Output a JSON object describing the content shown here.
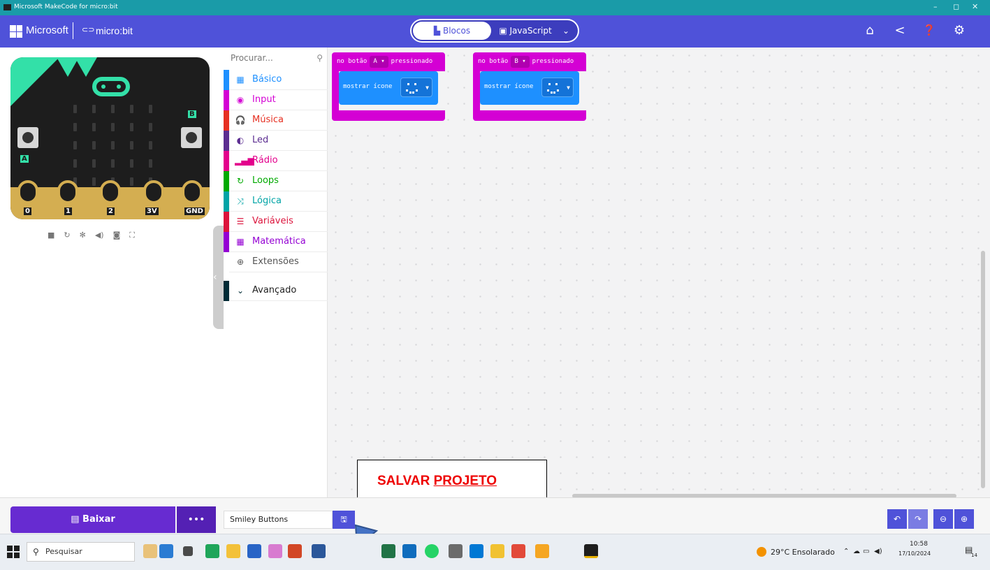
{
  "window": {
    "title": "Microsoft MakeCode for micro:bit",
    "controls": [
      "–",
      "◻",
      "✕"
    ]
  },
  "header": {
    "brand_microsoft": "Microsoft",
    "brand_microbit": "micro:bit",
    "mode_blocks": "Blocos",
    "mode_javascript": "JavaScript",
    "icons": [
      "home-icon",
      "share-icon",
      "help-icon",
      "settings-icon"
    ]
  },
  "simulator": {
    "button_a": "A",
    "button_b": "B",
    "pins": [
      "0",
      "1",
      "2",
      "3V",
      "GND"
    ],
    "controls": [
      "stop-icon",
      "restart-icon",
      "debug-icon",
      "mute-icon",
      "screenshot-icon",
      "fullscreen-icon"
    ]
  },
  "toolbox": {
    "search_placeholder": "Procurar...",
    "categories": [
      {
        "label": "Básico",
        "color": "#1e90ff",
        "icon": "grid-icon"
      },
      {
        "label": "Input",
        "color": "#d400d4",
        "icon": "input-icon"
      },
      {
        "label": "Música",
        "color": "#e63022",
        "icon": "headphones-icon"
      },
      {
        "label": "Led",
        "color": "#5c2d91",
        "icon": "toggle-icon"
      },
      {
        "label": "Rádio",
        "color": "#e3008c",
        "icon": "signal-icon"
      },
      {
        "label": "Loops",
        "color": "#00aa00",
        "icon": "loop-icon"
      },
      {
        "label": "Lógica",
        "color": "#00a4a6",
        "icon": "shuffle-icon"
      },
      {
        "label": "Variáveis",
        "color": "#dc143c",
        "icon": "list-icon"
      },
      {
        "label": "Matemática",
        "color": "#9400d3",
        "icon": "calculator-icon"
      },
      {
        "label": "Extensões",
        "color": "#555555",
        "icon": "plus-circle-icon"
      },
      {
        "label": "Avançado",
        "color": "#002b36",
        "icon": "chevron-down-icon"
      }
    ]
  },
  "workspace": {
    "blocks": [
      {
        "prefix": "no botão",
        "button": "A ▾",
        "suffix": "pressionado",
        "statement": "mostrar ícone"
      },
      {
        "prefix": "no botão",
        "button": "B ▾",
        "suffix": "pressionado",
        "statement": "mostrar ícone"
      }
    ],
    "callout_part1": "SALVAR",
    "callout_part2": "PROJETO"
  },
  "footer": {
    "download_label": "Baixar",
    "more_label": "•••",
    "project_name": "Smiley Buttons"
  },
  "taskbar": {
    "search_label": "Pesquisar",
    "weather": "29°C Ensolarado",
    "time": "10:58",
    "date": "17/10/2024",
    "notifications": "14"
  },
  "colors": {
    "accent": "#4f52d9",
    "download": "#672bd1",
    "input_block": "#d400d4",
    "basic_block": "#1e90ff",
    "microbit_green": "#33e0a8"
  }
}
